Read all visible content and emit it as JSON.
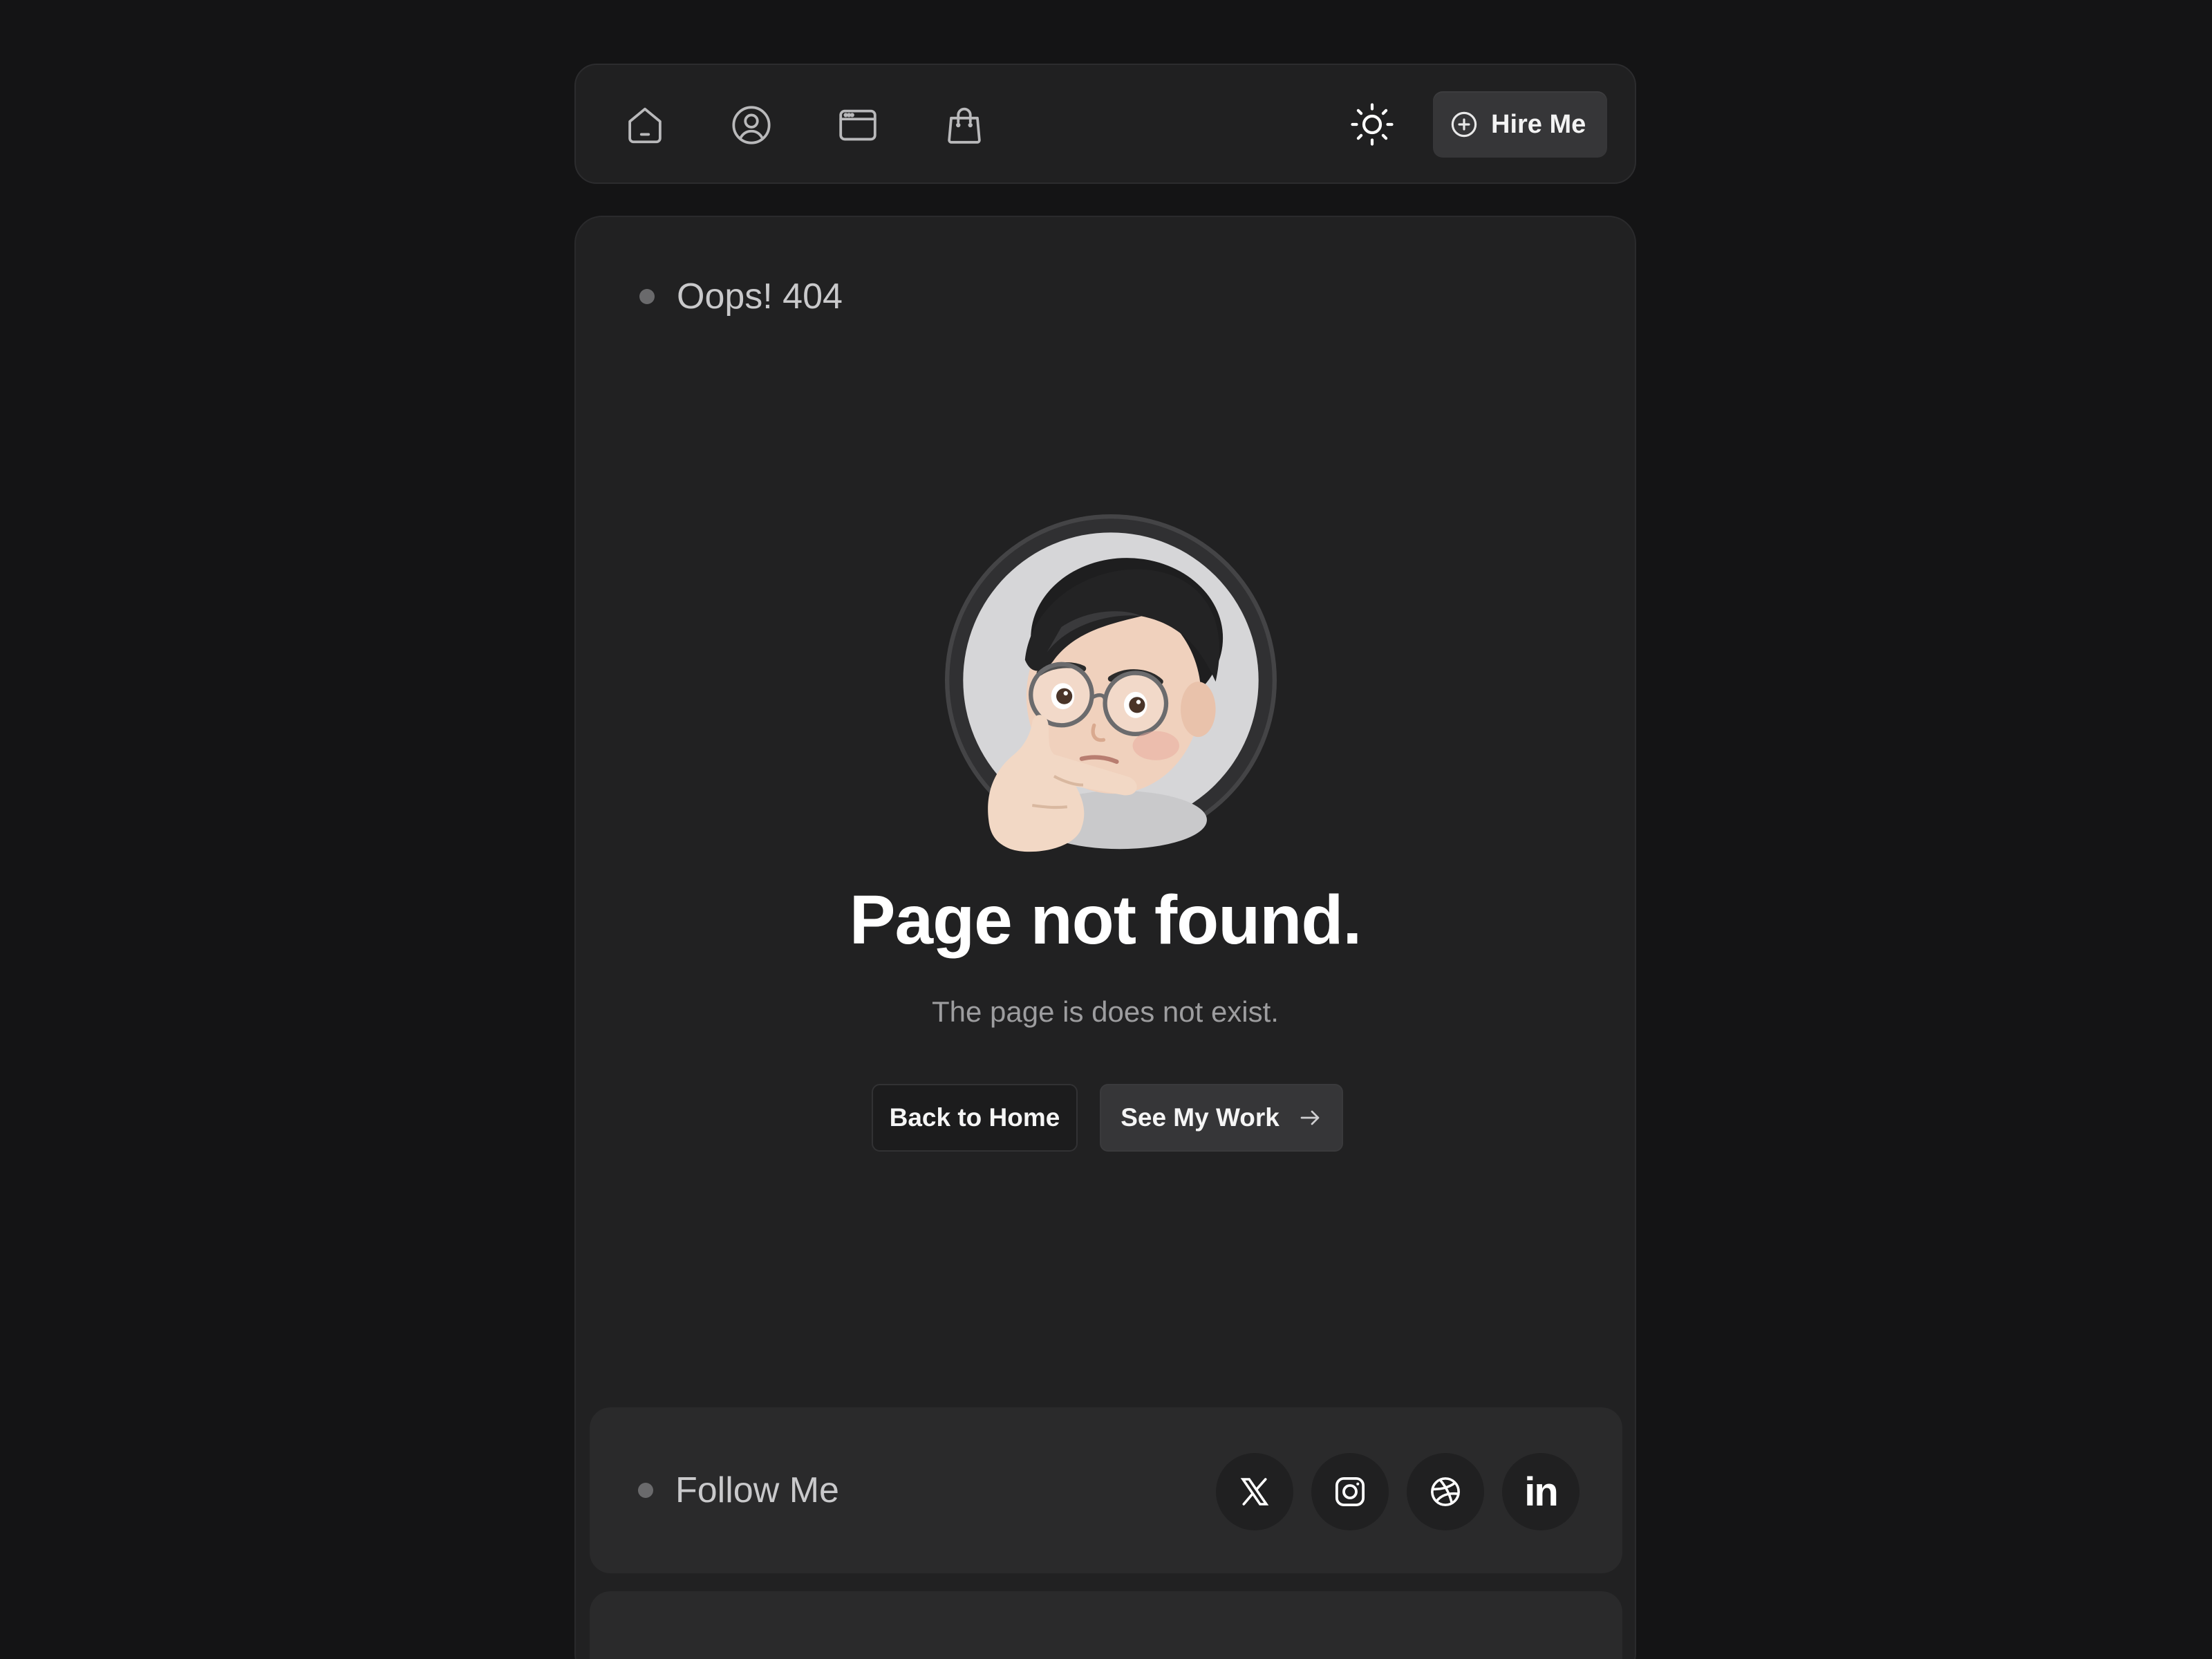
{
  "nav": {
    "icons": [
      "home-icon",
      "user-icon",
      "window-icon",
      "shopping-bag-icon"
    ],
    "theme_icon": "sun-icon",
    "hire_label": "Hire Me",
    "hire_icon": "plus-circle-icon"
  },
  "main": {
    "section_label": "Oops! 404",
    "avatar": "memoji-avatar",
    "title": "Page not found.",
    "subtitle": "The page is does not exist.",
    "back_home_label": "Back to Home",
    "see_work_label": "See My Work"
  },
  "follow": {
    "label": "Follow Me",
    "socials": [
      "x-icon",
      "instagram-icon",
      "dribbble-icon",
      "linkedin-icon"
    ],
    "linkedin_text": "in"
  },
  "colors": {
    "background": "#141415",
    "card": "#212122",
    "inner_card": "#2a2a2b",
    "text_primary": "#ffffff",
    "text_secondary": "#9d9d9f"
  }
}
